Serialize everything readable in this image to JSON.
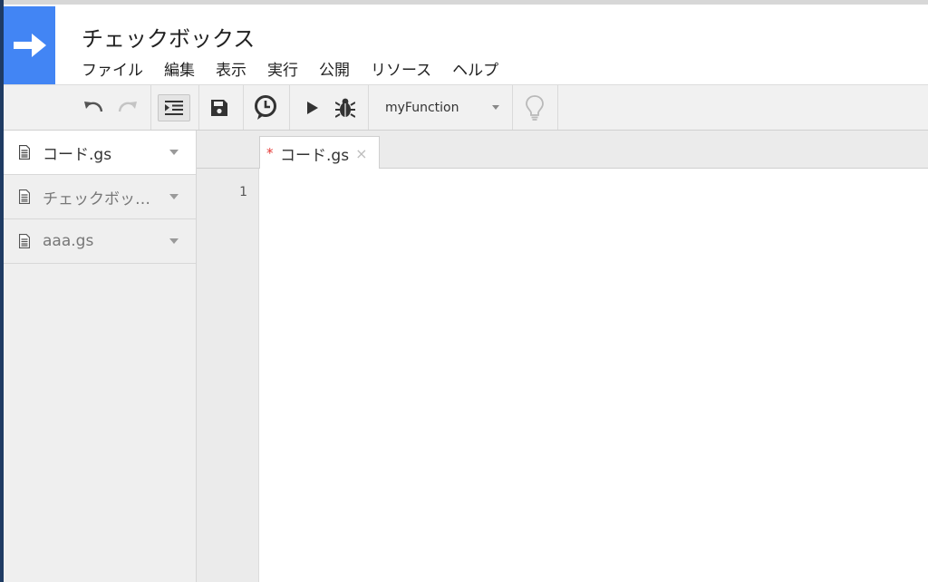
{
  "header": {
    "title": "チェックボックス",
    "menu": [
      "ファイル",
      "編集",
      "表示",
      "実行",
      "公開",
      "リソース",
      "ヘルプ"
    ]
  },
  "toolbar": {
    "function_selected": "myFunction",
    "icons": [
      "undo-icon",
      "redo-icon",
      "indent-icon",
      "save-icon",
      "clock-icon",
      "play-icon",
      "bug-icon",
      "lightbulb-icon"
    ]
  },
  "sidebar": {
    "files": [
      {
        "name": "コード.gs",
        "active": true
      },
      {
        "name": "チェックボッ…",
        "active": false
      },
      {
        "name": "aaa.gs",
        "active": false
      }
    ]
  },
  "editor": {
    "tab_label": "コード.gs",
    "tab_modified_mark": "*",
    "tab_close": "×",
    "line_numbers": [
      "1"
    ]
  },
  "colors": {
    "brand_blue": "#4285f4",
    "modified_red": "#e53935"
  }
}
